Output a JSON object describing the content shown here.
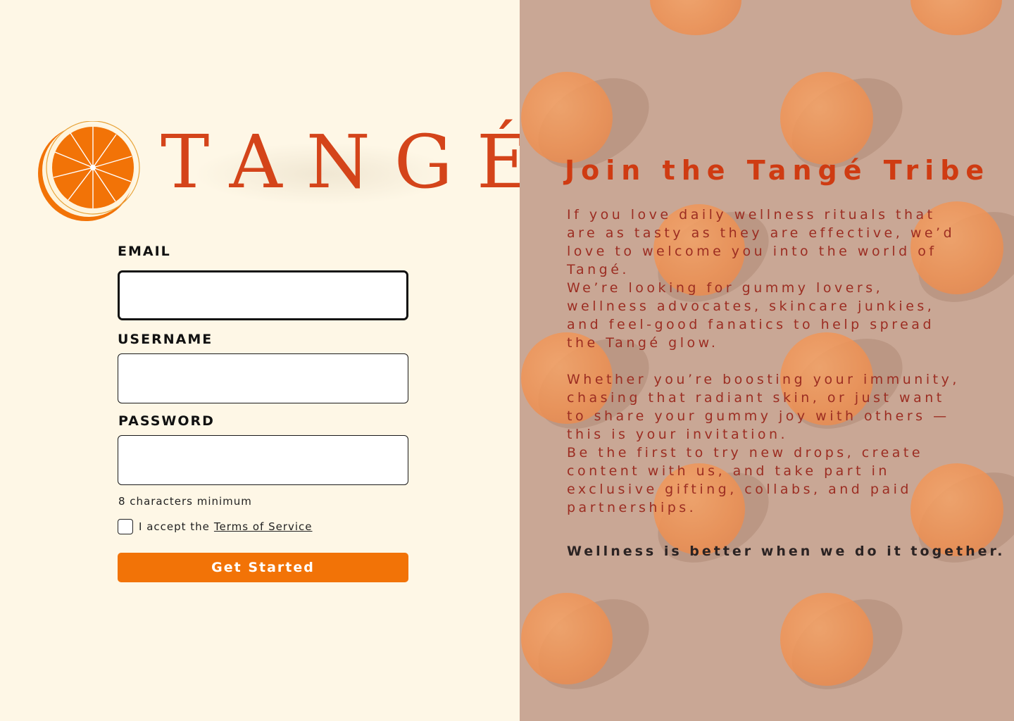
{
  "brand": {
    "wordmark": "TANGÉ",
    "logo_icon": "orange-slice-icon",
    "accent_color": "#f27307",
    "wordmark_color": "#d4441a"
  },
  "form": {
    "email_label": "EMAIL",
    "email_value": "",
    "username_label": "USERNAME",
    "username_value": "",
    "password_label": "PASSWORD",
    "password_value": "",
    "password_hint": "8 characters minimum",
    "tos_prefix": "I accept the",
    "tos_link": "Terms of Service",
    "tos_checked": false,
    "submit_label": "Get Started"
  },
  "promo": {
    "title": "Join the Tangé Tribe",
    "paragraph_1": "If you love daily wellness rituals that are as tasty as they are effective, we’d love to welcome you into the world of Tangé.",
    "paragraph_2": "We’re looking for gummy lovers, wellness advocates, skincare junkies, and feel-good fanatics to help spread the Tangé glow.",
    "paragraph_3": "Whether you’re boosting your immunity, chasing that radiant skin, or just want to share your gummy joy with others — this is your invitation.",
    "paragraph_4": "Be the first to try new drops, create content with us, and take part in exclusive gifting, collabs, and paid partnerships.",
    "tagline": "Wellness is better when we do it together.",
    "title_color": "#cf3b12",
    "body_color": "#9c2d22",
    "background_color": "#c9a795"
  }
}
